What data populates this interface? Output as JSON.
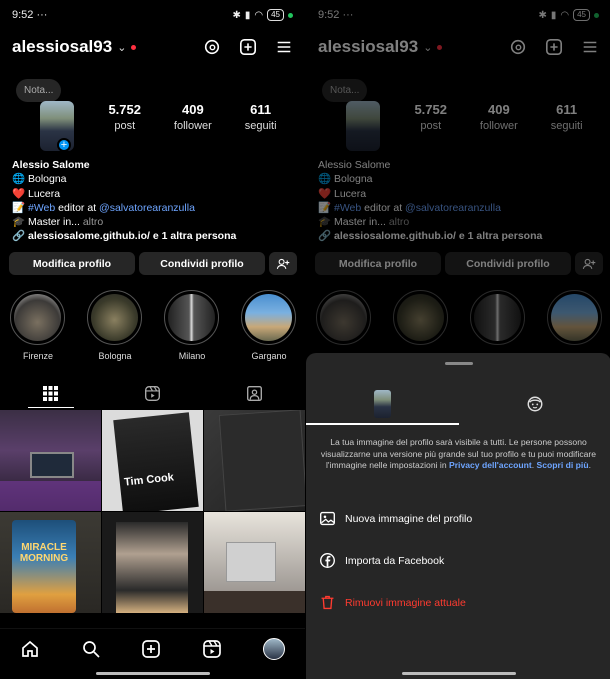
{
  "status": {
    "time": "9:52",
    "dots": "···",
    "battery": "45"
  },
  "profile": {
    "username": "alessiosal93",
    "note_placeholder": "Nota...",
    "stats": [
      {
        "value": "5.752",
        "label": "post"
      },
      {
        "value": "409",
        "label": "follower"
      },
      {
        "value": "611",
        "label": "seguiti"
      }
    ],
    "bio": {
      "name": "Alessio Salome",
      "line_city": "🌐 Bologna",
      "line_home": "❤️ Lucera",
      "web_prefix": "📝 ",
      "web_tag": "#Web",
      "web_middle": " editor at ",
      "web_mention": "@salvatorearanzulla",
      "master": "🎓 Master in... ",
      "altro": "altro",
      "link": "alessiosalome.github.io/",
      "link_more": " e 1 altra persona"
    },
    "buttons": {
      "edit": "Modifica profilo",
      "share": "Condividi profilo"
    },
    "highlights": [
      {
        "label": "Firenze"
      },
      {
        "label": "Bologna"
      },
      {
        "label": "Milano"
      },
      {
        "label": "Gargano"
      }
    ]
  },
  "grid_posts": [
    {
      "title": ""
    },
    {
      "title": "Tim Cook"
    },
    {
      "title": ""
    },
    {
      "title": "MIRACLE MORNING"
    },
    {
      "title": ""
    },
    {
      "title": ""
    }
  ],
  "sheet": {
    "description": "La tua immagine del profilo sarà visibile a tutti. Le persone possono visualizzarne una versione più grande sul tuo profilo e tu puoi modificare l'immagine nelle impostazioni in ",
    "privacy_link": "Privacy dell'account",
    "more_link": "Scopri di più",
    "options": [
      {
        "label": "Nuova immagine del profilo"
      },
      {
        "label": "Importa da Facebook"
      },
      {
        "label": "Rimuovi immagine attuale"
      }
    ]
  },
  "colors": {
    "accent": "#0095f6",
    "link": "#6ea5ff",
    "danger": "#ff3b30"
  }
}
